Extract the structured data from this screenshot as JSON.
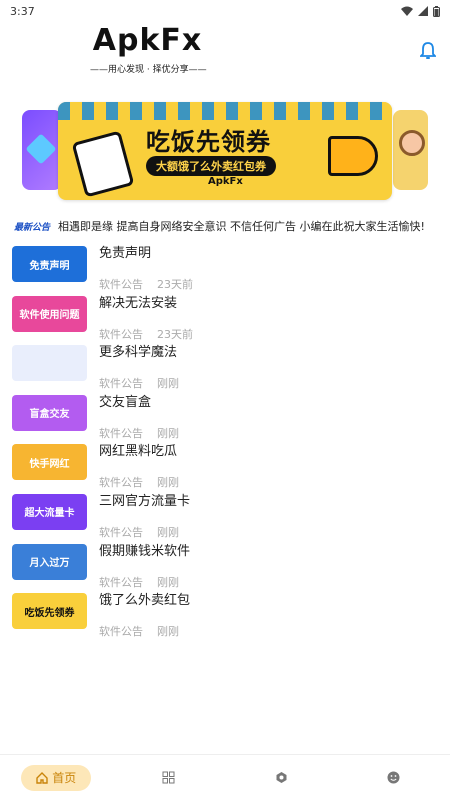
{
  "status": {
    "time": "3:37"
  },
  "header": {
    "logo": "ApkFx",
    "slogan": "——用心发现 · 择优分享——"
  },
  "banner": {
    "title": "吃饭先领券",
    "subtitle": "大额饿了么外卖红包券",
    "brand": "ApkFx"
  },
  "notice": {
    "tag": "最新公告",
    "text": "相遇即是缘  提高自身网络安全意识  不信任何广告  小编在此祝大家生活愉快!"
  },
  "items": [
    {
      "title": "免责声明",
      "category": "软件公告",
      "time": "23天前",
      "thumb_label": "免责声明",
      "thumb_color": "#1e6fd9"
    },
    {
      "title": "解决无法安装",
      "category": "软件公告",
      "time": "23天前",
      "thumb_label": "软件使用问题",
      "thumb_color": "#e8489b"
    },
    {
      "title": "更多科学魔法",
      "category": "软件公告",
      "time": "刚刚",
      "thumb_label": "",
      "thumb_color": "#e9eefc"
    },
    {
      "title": "交友盲盒",
      "category": "软件公告",
      "time": "刚刚",
      "thumb_label": "盲盒交友",
      "thumb_color": "#b35cf0"
    },
    {
      "title": "网红黑料吃瓜",
      "category": "软件公告",
      "time": "刚刚",
      "thumb_label": "快手网红",
      "thumb_color": "#f7b531"
    },
    {
      "title": "三网官方流量卡",
      "category": "软件公告",
      "time": "刚刚",
      "thumb_label": "超大流量卡",
      "thumb_color": "#7b3ff2"
    },
    {
      "title": "假期赚钱米软件",
      "category": "软件公告",
      "time": "刚刚",
      "thumb_label": "月入过万",
      "thumb_color": "#3a7fd8"
    },
    {
      "title": "饿了么外卖红包",
      "category": "软件公告",
      "time": "刚刚",
      "thumb_label": "吃饭先领券",
      "thumb_color": "#f9cf3b"
    }
  ],
  "tabbar": {
    "home_label": "首页",
    "accent": "#c9840a"
  }
}
